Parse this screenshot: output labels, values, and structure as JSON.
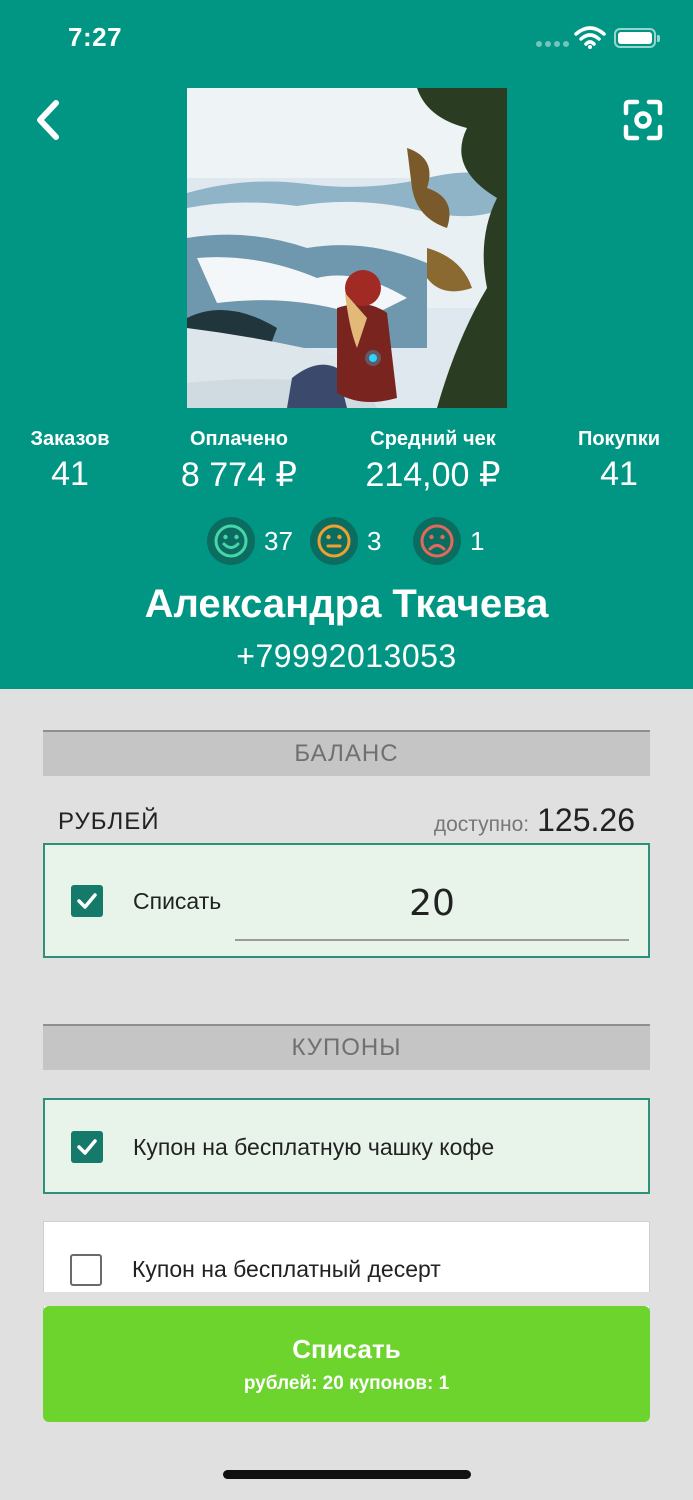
{
  "status_bar": {
    "time": "7:27"
  },
  "icons": {
    "back": "chevron-left-icon",
    "scan": "scan-icon",
    "wifi": "wifi-icon",
    "battery": "battery-icon"
  },
  "colors": {
    "header": "#009683",
    "accent": "#157a6a",
    "button": "#6cd42d",
    "happy": "#47d6a8",
    "neutral": "#f0a030",
    "sad": "#e06a5c"
  },
  "stats": [
    {
      "label": "Заказов",
      "value": "41"
    },
    {
      "label": "Оплачено",
      "value": "8 774 ₽"
    },
    {
      "label": "Средний чек",
      "value": "214,00 ₽"
    },
    {
      "label": "Покупки",
      "value": "41"
    }
  ],
  "ratings": {
    "happy": "37",
    "neutral": "3",
    "sad": "1"
  },
  "customer": {
    "name": "Александра Ткачева",
    "phone": "+79992013053"
  },
  "balance": {
    "section_title": "БАЛАНС",
    "currency_label": "РУБЛЕЙ",
    "available_label": "доступно:",
    "available_value": "125.26",
    "debit_label": "Списать",
    "debit_checked": true,
    "debit_amount": "20"
  },
  "coupons": {
    "section_title": "КУПОНЫ",
    "items": [
      {
        "label": "Купон на бесплатную чашку кофе",
        "checked": true
      },
      {
        "label": "Купон на бесплатный десерт",
        "checked": false
      }
    ]
  },
  "submit": {
    "title": "Списать",
    "subtitle": "рублей: 20 купонов: 1"
  }
}
